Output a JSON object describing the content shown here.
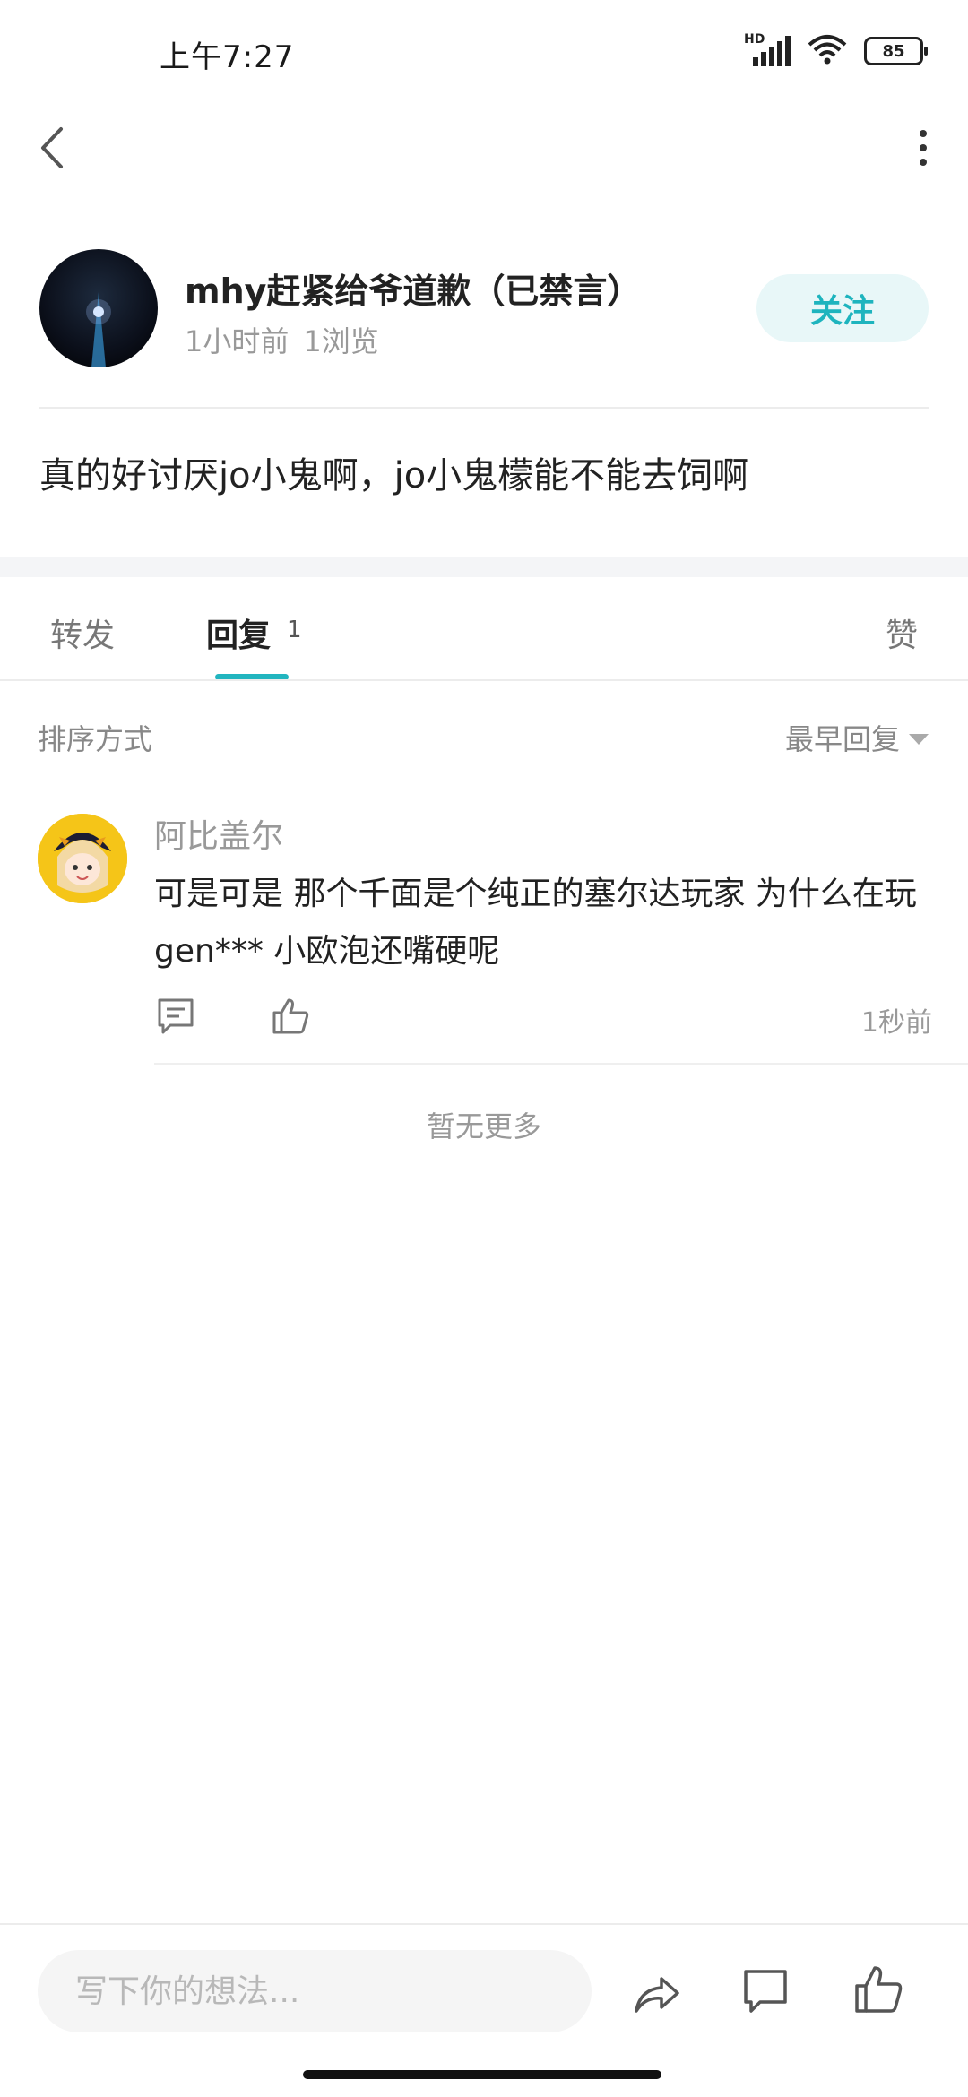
{
  "status_bar": {
    "time": "上午7:27",
    "network_label": "HD",
    "battery": "85"
  },
  "author": {
    "name": "mhy赶紧给爷道歉（已禁言）",
    "time": "1小时前",
    "views": "1浏览",
    "follow_label": "关注"
  },
  "post": {
    "content": "真的好讨厌jo小鬼啊，jo小鬼檬能不能去饲啊"
  },
  "tabs": {
    "forward": "转发",
    "reply": "回复",
    "reply_count": "1",
    "like": "赞"
  },
  "sort": {
    "label": "排序方式",
    "value": "最早回复"
  },
  "comment": {
    "user": "阿比盖尔",
    "text": "可是可是 那个千面是个纯正的塞尔达玩家 为什么在玩gen*** 小欧泡还嘴硬呢",
    "time": "1秒前"
  },
  "no_more": "暂无更多",
  "input": {
    "placeholder": "写下你的想法..."
  },
  "colors": {
    "accent": "#22b5bf",
    "follow_bg": "#e8f7f8"
  }
}
